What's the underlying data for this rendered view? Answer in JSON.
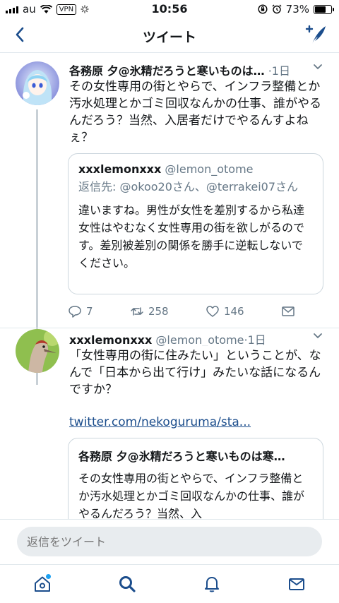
{
  "status_bar": {
    "carrier": "au",
    "vpn": "VPN",
    "time": "10:56",
    "battery_percent": "73%",
    "battery_level": 0.73
  },
  "nav": {
    "title": "ツイート"
  },
  "tweets": [
    {
      "name": "各務原 夕@氷精だろうと寒いものは…",
      "time": "·1日",
      "text": "その女性専用の街とやらで、インフラ整備とか汚水処理とかゴミ回収なんかの仕事、誰がやるんだろう？当然、入居者だけでやるんすよねぇ？",
      "quote": {
        "name": "xxxlemonxxx",
        "handle": "@lemon_otome",
        "reply_to": "返信先: @okoo20さん、@terrakei07さん",
        "text": "違いますね。男性が女性を差別するから私達女性はやむなく女性専用の街を欲しがるのです。差別被差別の関係を勝手に逆転しないでください。"
      },
      "actions": {
        "replies": "7",
        "retweets": "258",
        "likes": "146"
      }
    },
    {
      "name": "xxxlemonxxx",
      "handle": "@lemon_otome",
      "time": "·1日",
      "text": "「女性専用の街に住みたい」ということが、なんで「日本から出て行け」みたいな話になるんですか？",
      "link": "twitter.com/nekoguruma/sta...",
      "quote": {
        "name": "各務原 夕@氷精だろうと寒いものは寒…",
        "text": "その女性専用の街とやらで、インフラ整備とか汚水処理とかゴミ回収なんかの仕事、誰がやるんだろう？当然、入"
      }
    }
  ],
  "reply": {
    "placeholder": "返信をツイート"
  },
  "tabs": [
    "home-icon",
    "search-icon",
    "notifications-icon",
    "messages-icon"
  ],
  "colors": {
    "accent": "#1da1f2",
    "nav_blue": "#1b4d8c",
    "muted": "#657786"
  }
}
